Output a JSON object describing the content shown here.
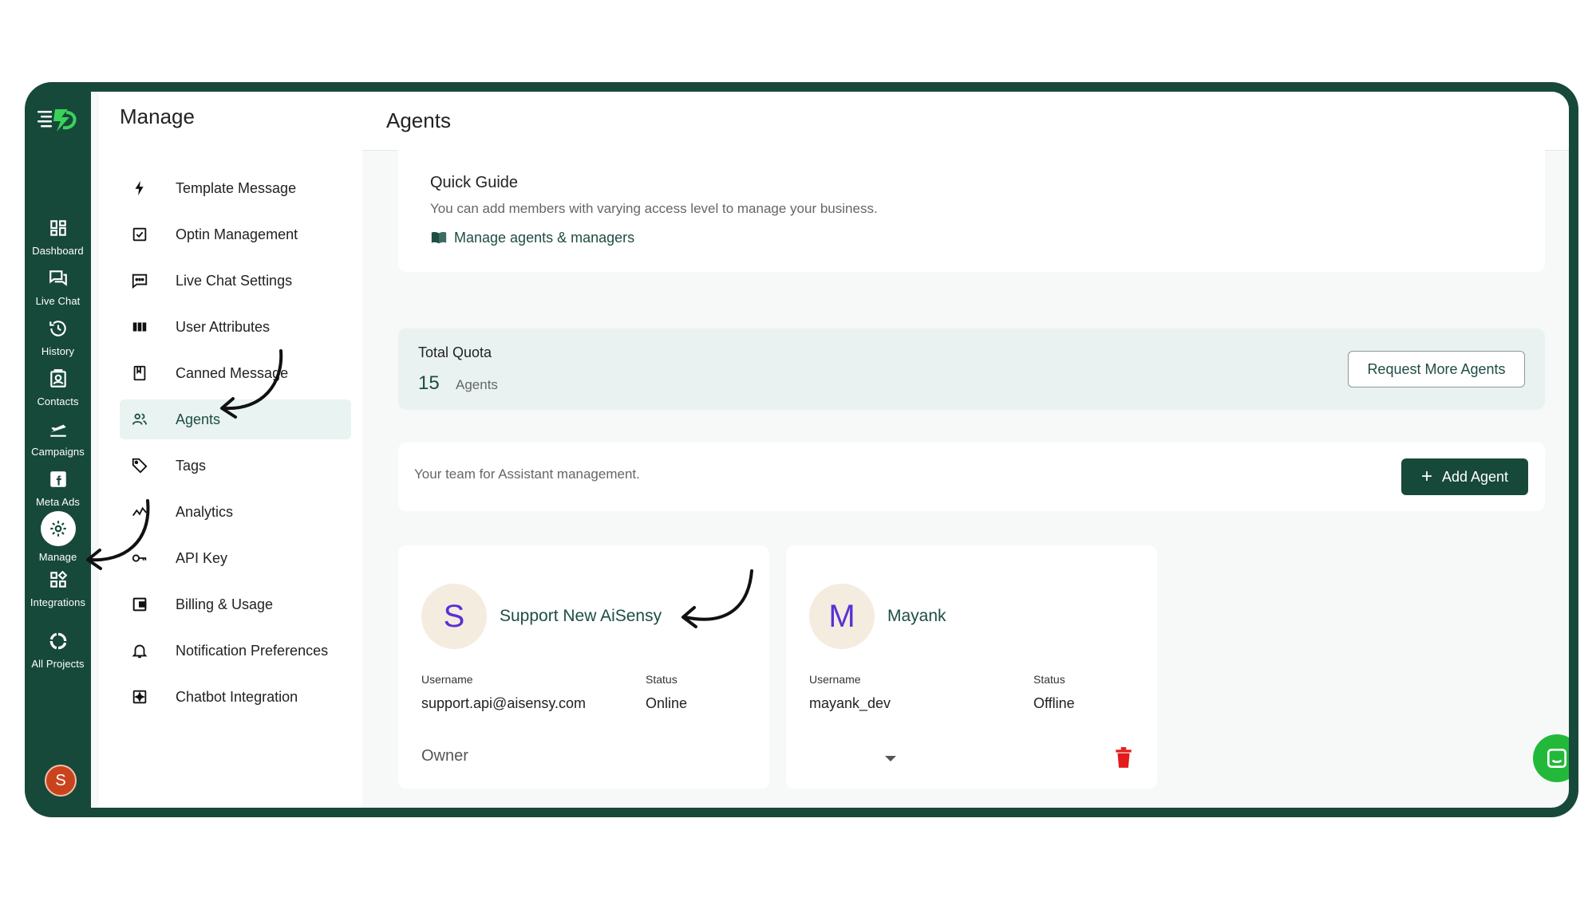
{
  "rail": {
    "items": [
      {
        "label": "Dashboard",
        "icon": "dashboard-icon"
      },
      {
        "label": "Live Chat",
        "icon": "live-chat-icon"
      },
      {
        "label": "History",
        "icon": "history-icon"
      },
      {
        "label": "Contacts",
        "icon": "contacts-icon"
      },
      {
        "label": "Campaigns",
        "icon": "campaigns-icon"
      },
      {
        "label": "Meta Ads",
        "icon": "facebook-icon"
      },
      {
        "label": "Manage",
        "icon": "gear-icon",
        "active": true
      },
      {
        "label": "Integrations",
        "icon": "integrations-icon"
      },
      {
        "label": "All Projects",
        "icon": "projects-icon"
      }
    ],
    "avatar_letter": "S"
  },
  "sidebar": {
    "title": "Manage",
    "items": [
      {
        "label": "Template Message",
        "icon": "lightning-icon"
      },
      {
        "label": "Optin Management",
        "icon": "checkbox-icon"
      },
      {
        "label": "Live Chat Settings",
        "icon": "chat-bubble-icon"
      },
      {
        "label": "User Attributes",
        "icon": "columns-icon"
      },
      {
        "label": "Canned Message",
        "icon": "bookmark-icon"
      },
      {
        "label": "Agents",
        "icon": "people-icon",
        "active": true
      },
      {
        "label": "Tags",
        "icon": "tag-icon"
      },
      {
        "label": "Analytics",
        "icon": "analytics-icon"
      },
      {
        "label": "API Key",
        "icon": "key-icon"
      },
      {
        "label": "Billing & Usage",
        "icon": "wallet-icon"
      },
      {
        "label": "Notification Preferences",
        "icon": "bell-icon"
      },
      {
        "label": "Chatbot Integration",
        "icon": "chatbot-icon"
      }
    ]
  },
  "header": {
    "title": "Agents"
  },
  "guide": {
    "title": "Quick Guide",
    "description": "You can add members with varying access level to manage your business.",
    "link": "Manage agents & managers"
  },
  "quota": {
    "label": "Total Quota",
    "value": "15",
    "unit": "Agents",
    "request_button": "Request More Agents"
  },
  "team": {
    "text": "Your team for Assistant management.",
    "add_button": "Add Agent"
  },
  "agents": [
    {
      "initial": "S",
      "name": "Support New AiSensy",
      "username_label": "Username",
      "username": "support.api@aisensy.com",
      "status_label": "Status",
      "status": "Online",
      "role": "Owner"
    },
    {
      "initial": "M",
      "name": "Mayank",
      "username_label": "Username",
      "username": "mayank_dev",
      "status_label": "Status",
      "status": "Offline",
      "role": ""
    }
  ],
  "colors": {
    "brand": "#17493b",
    "accent_text": "#1d4d44",
    "active_bg": "#e9f3f1",
    "delete": "#e31b1b",
    "chat_fab": "#22b93a"
  }
}
